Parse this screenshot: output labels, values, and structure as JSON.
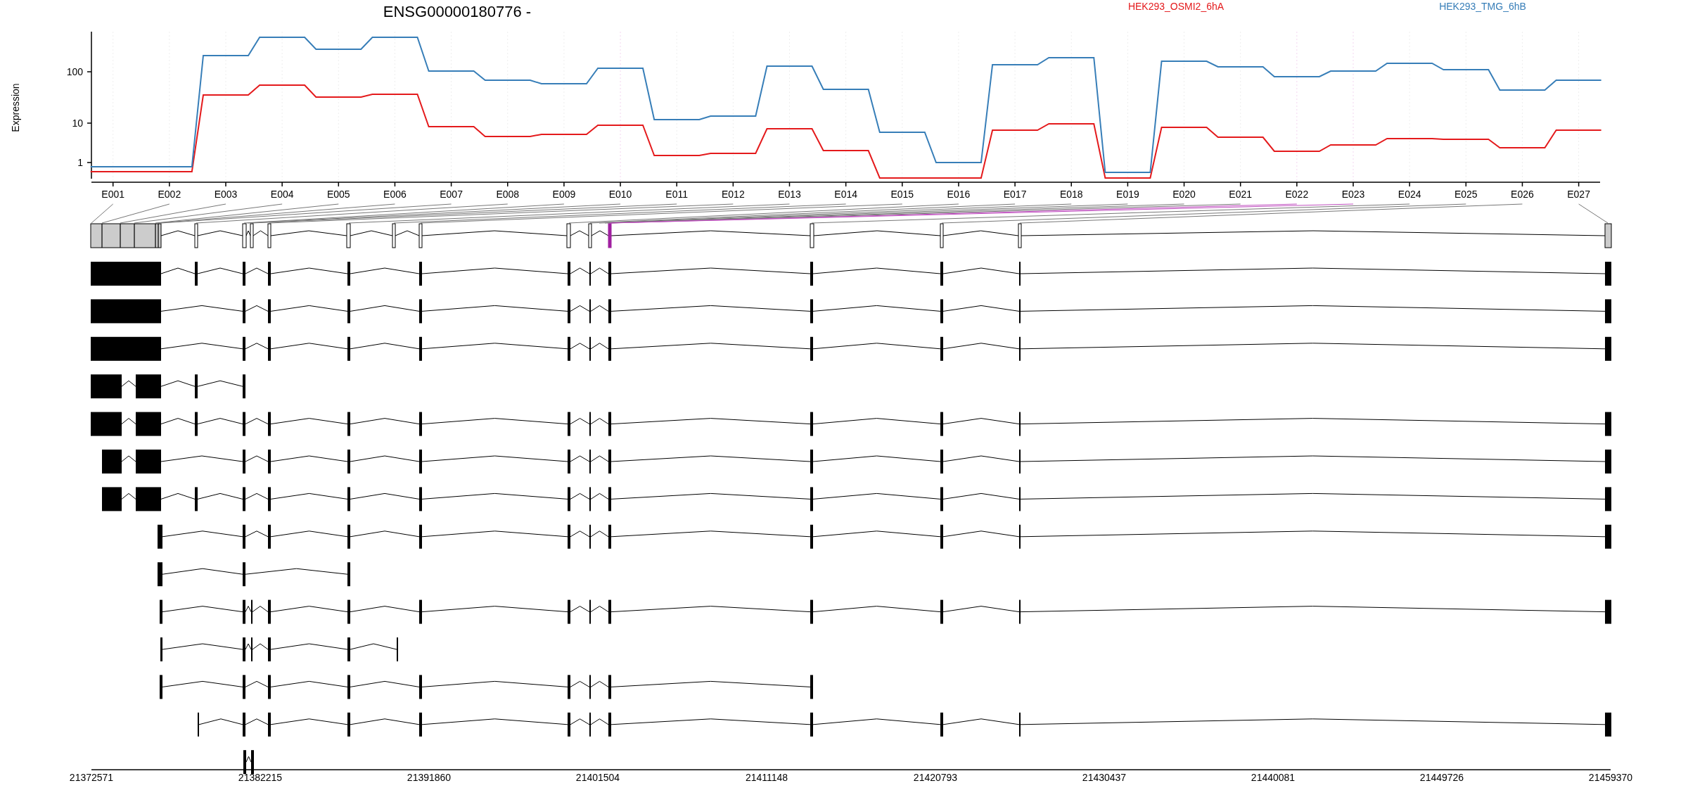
{
  "title": "ENSG00000180776 -",
  "legend": [
    {
      "label": "HEK293_OSMI2_6hA",
      "color": "#e41a1c"
    },
    {
      "label": "HEK293_TMG_6hB",
      "color": "#377eb8"
    }
  ],
  "y_axis": {
    "title": "Expression",
    "labels": [
      "100",
      "10",
      "1"
    ]
  },
  "exon_labels": [
    "E001",
    "E002",
    "E003",
    "E004",
    "E005",
    "E006",
    "E007",
    "E008",
    "E009",
    "E010",
    "E011",
    "E012",
    "E013",
    "E014",
    "E015",
    "E016",
    "E017",
    "E018",
    "E019",
    "E020",
    "E021",
    "E022",
    "E023",
    "E024",
    "E025",
    "E026",
    "E027"
  ],
  "genomic_axis": {
    "ticks": [
      "21372571",
      "21382215",
      "21391860",
      "21401504",
      "21411148",
      "21420793",
      "21430437",
      "21440081",
      "21449726",
      "21459370"
    ]
  }
}
